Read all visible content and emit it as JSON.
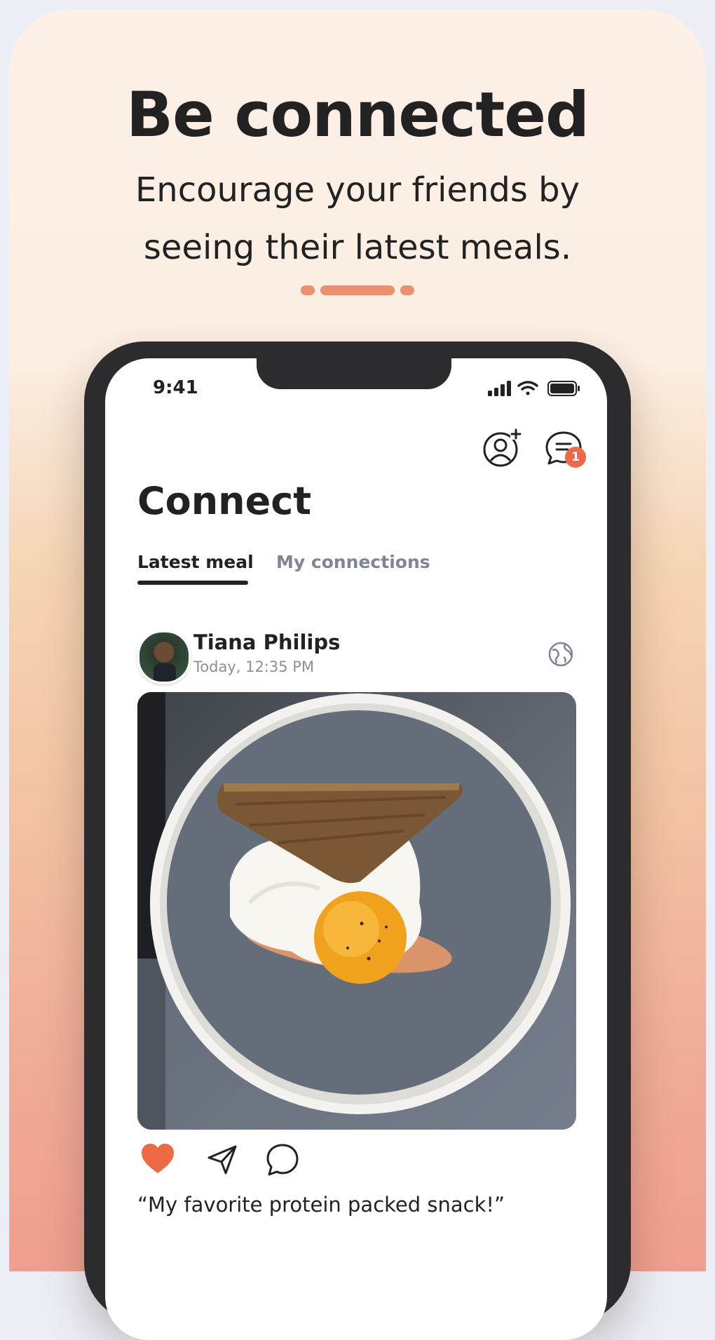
{
  "promo": {
    "headline": "Be connected",
    "subline_1": "Encourage your friends by",
    "subline_2": "seeing their latest meals."
  },
  "status_bar": {
    "time": "9:41"
  },
  "app": {
    "title": "Connect",
    "notification_count": "1",
    "tabs": [
      {
        "label": "Latest meal",
        "active": true
      },
      {
        "label": "My connections",
        "active": false
      }
    ]
  },
  "post": {
    "user_name": "Tiana Philips",
    "timestamp": "Today, 12:35 PM",
    "caption": "“My favorite protein packed snack!”",
    "liked": true
  },
  "icons": {
    "add_user": "add-user-icon",
    "messages": "chat-list-icon",
    "visibility": "globe-icon",
    "like": "heart-icon",
    "share": "send-icon",
    "comment": "comment-icon"
  },
  "colors": {
    "accent": "#ec6a45",
    "text": "#222222",
    "muted": "#7f8593",
    "indicator": "#ec8f6f"
  },
  "carousel": {
    "page_count": 3,
    "active_index": 1
  }
}
